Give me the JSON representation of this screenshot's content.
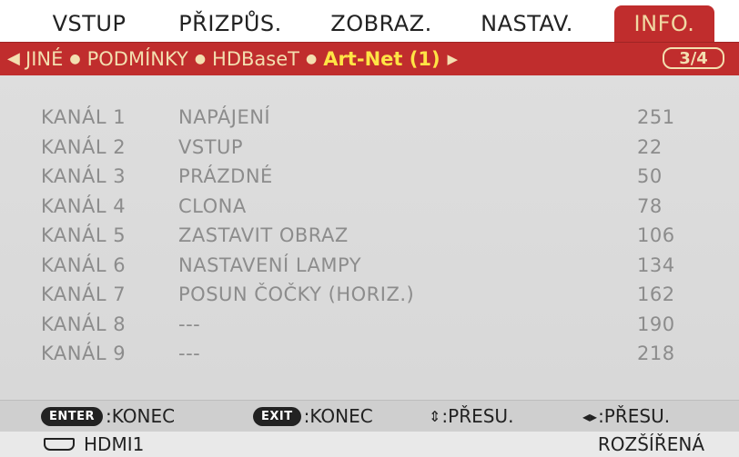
{
  "menu": {
    "tabs": [
      {
        "label": "VSTUP"
      },
      {
        "label": "PŘIZPŮS."
      },
      {
        "label": "ZOBRAZ."
      },
      {
        "label": "NASTAV."
      },
      {
        "label": "INFO."
      }
    ],
    "active_tab": "INFO."
  },
  "submenu": {
    "items": [
      "JINÉ",
      "PODMÍNKY",
      "HDBaseT"
    ],
    "current": "Art-Net (1)",
    "separator": "●",
    "left_arrow": "◀",
    "right_arrow": "▶",
    "page": "3/4"
  },
  "channels": [
    {
      "channel": "KANÁL 1",
      "function": "NAPÁJENÍ",
      "value": "251"
    },
    {
      "channel": "KANÁL 2",
      "function": "VSTUP",
      "value": "22"
    },
    {
      "channel": "KANÁL 3",
      "function": "PRÁZDNÉ",
      "value": "50"
    },
    {
      "channel": "KANÁL 4",
      "function": "CLONA",
      "value": "78"
    },
    {
      "channel": "KANÁL 5",
      "function": "ZASTAVIT OBRAZ",
      "value": "106"
    },
    {
      "channel": "KANÁL 6",
      "function": "NASTAVENÍ LAMPY",
      "value": "134"
    },
    {
      "channel": "KANÁL 7",
      "function": "POSUN ČOČKY (HORIZ.)",
      "value": "162"
    },
    {
      "channel": "KANÁL 8",
      "function": "---",
      "value": "190"
    },
    {
      "channel": "KANÁL 9",
      "function": "---",
      "value": "218"
    }
  ],
  "help": {
    "enter_key": "ENTER",
    "enter_label": ":KONEC",
    "exit_key": "EXIT",
    "exit_label": ":KONEC",
    "updown_glyph": "⇕",
    "updown_label": ":PŘESU.",
    "leftright_glyph": "◂▸",
    "leftright_label": ":PŘESU."
  },
  "status": {
    "source_icon": "hdmi-connector-icon",
    "source": "HDMI1",
    "mode": "ROZŠÍŘENÁ"
  },
  "colors": {
    "accent_red": "#c02d2d",
    "highlight_yellow": "#ffe445",
    "menu_cream": "#f3dfb0",
    "disabled_text": "#8c8c8c"
  }
}
